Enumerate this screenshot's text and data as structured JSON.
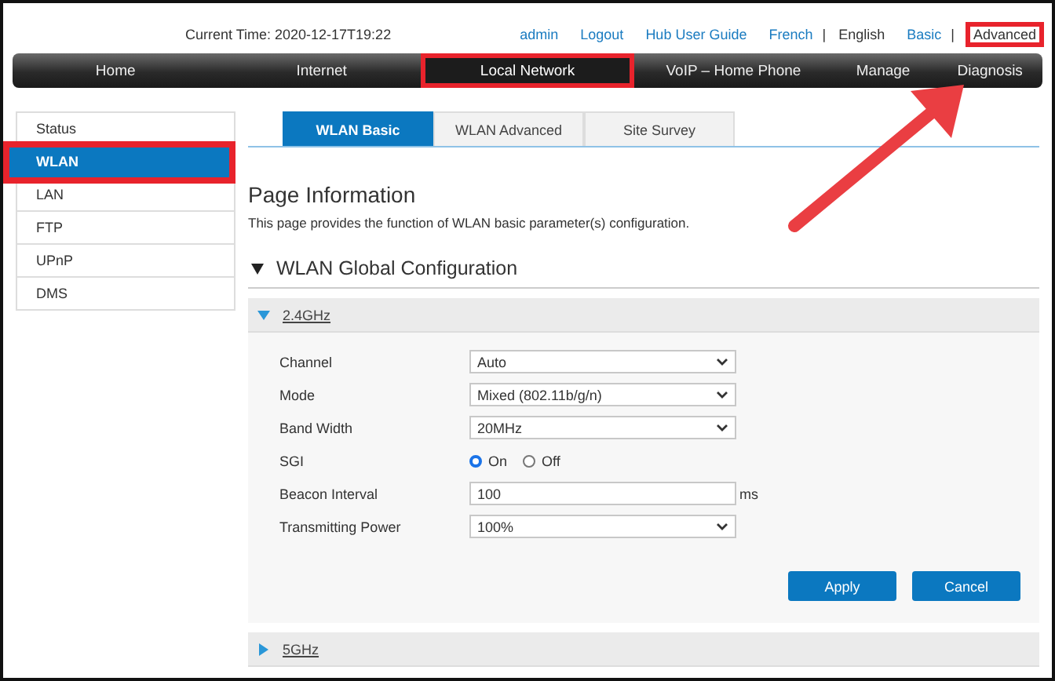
{
  "header": {
    "time_label": "Current Time: 2020-12-17T19:22",
    "links": [
      {
        "label": "admin",
        "kind": "link",
        "highlighted": false
      },
      {
        "label": "Logout",
        "kind": "link",
        "highlighted": false
      },
      {
        "label": "Hub User Guide",
        "kind": "link",
        "highlighted": false
      },
      {
        "label": "French",
        "kind": "link",
        "highlighted": false
      },
      {
        "label": "|",
        "kind": "separator",
        "highlighted": false
      },
      {
        "label": "English",
        "kind": "current",
        "highlighted": false
      },
      {
        "label": "Basic",
        "kind": "link",
        "highlighted": false
      },
      {
        "label": "|",
        "kind": "separator",
        "highlighted": false
      },
      {
        "label": "Advanced",
        "kind": "current",
        "highlighted": true
      }
    ]
  },
  "nav": [
    {
      "label": "Home",
      "selected": false,
      "highlighted": false
    },
    {
      "label": "Internet",
      "selected": false,
      "highlighted": false
    },
    {
      "label": "Local Network",
      "selected": true,
      "highlighted": true
    },
    {
      "label": "VoIP – Home Phone",
      "selected": false,
      "highlighted": false
    },
    {
      "label": "Manage",
      "label_end": "Diagnosis",
      "selected": false,
      "highlighted": false
    }
  ],
  "sidebar": {
    "items": [
      {
        "label": "Status",
        "selected": false,
        "highlighted": false
      },
      {
        "label": "WLAN",
        "selected": true,
        "highlighted": true
      },
      {
        "label": "LAN",
        "selected": false,
        "highlighted": false
      },
      {
        "label": "FTP",
        "selected": false,
        "highlighted": false
      },
      {
        "label": "UPnP",
        "selected": false,
        "highlighted": false
      },
      {
        "label": "DMS",
        "selected": false,
        "highlighted": false
      }
    ]
  },
  "tabs": [
    {
      "label": "WLAN Basic",
      "selected": true
    },
    {
      "label": "WLAN Advanced",
      "selected": false
    },
    {
      "label": "Site Survey",
      "selected": false
    }
  ],
  "page_title": "Page Information",
  "description": "This page provides the function of WLAN basic parameter(s) configuration.",
  "section": {
    "title": "WLAN Global Configuration",
    "expanded": true
  },
  "bands": [
    {
      "label": "2.4GHz",
      "expanded": true,
      "fields": [
        {
          "kind": "select",
          "label": "Channel",
          "value": "Auto"
        },
        {
          "kind": "select",
          "label": "Mode",
          "value": "Mixed (802.11b/g/n)"
        },
        {
          "kind": "select",
          "label": "Band Width",
          "value": "20MHz"
        },
        {
          "kind": "radio",
          "label": "SGI",
          "options": [
            {
              "label": "On",
              "selected": true
            },
            {
              "label": "Off",
              "selected": false
            }
          ]
        },
        {
          "kind": "input",
          "label": "Beacon Interval",
          "value": "100",
          "unit": "ms"
        },
        {
          "kind": "select",
          "label": "Transmitting Power",
          "value": "100%"
        }
      ],
      "buttons": [
        "Apply",
        "Cancel"
      ]
    },
    {
      "label": "5GHz",
      "expanded": false
    }
  ],
  "annotations": [
    {
      "kind": "arrow"
    }
  ]
}
